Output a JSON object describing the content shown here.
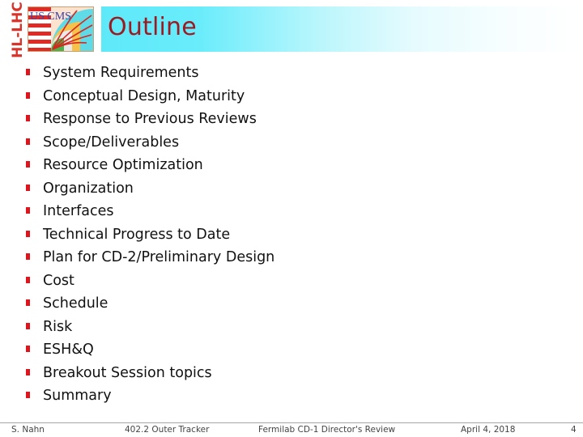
{
  "header": {
    "side_label": "HL-LHC",
    "logo_text": "US CMS",
    "title": "Outline"
  },
  "outline_items": [
    "System Requirements",
    "Conceptual Design, Maturity",
    "Response to Previous Reviews",
    "Scope/Deliverables",
    "Resource Optimization",
    "Organization",
    "Interfaces",
    "Technical Progress to Date",
    "Plan for CD-2/Preliminary Design",
    "Cost",
    "Schedule",
    "Risk",
    "ESH&Q",
    "Breakout Session topics",
    "Summary"
  ],
  "footer": {
    "author": "S. Nahn",
    "project": "402.2 Outer Tracker",
    "event": "Fermilab CD-1 Director's Review",
    "date": "April 4, 2018",
    "page_number": "4"
  },
  "colors": {
    "title_text": "#9b1b22",
    "bullet": "#e0141c",
    "hl_lhc": "#d9342b",
    "title_bar_start": "#5ee9f9"
  }
}
